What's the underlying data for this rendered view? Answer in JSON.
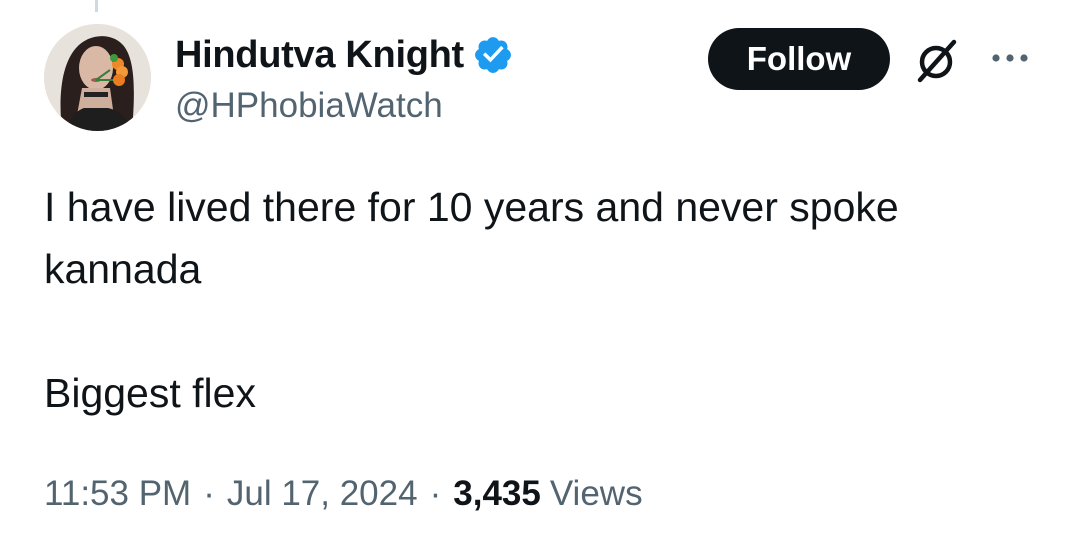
{
  "tweet": {
    "author": {
      "display_name": "Hindutva Knight",
      "handle": "@HPhobiaWatch",
      "verified": true,
      "verified_color": "#1d9bf0",
      "avatar_icon": "avatar-photo"
    },
    "actions": {
      "follow_label": "Follow",
      "grok_icon": "grok-icon",
      "more_icon": "more-options-icon"
    },
    "text": "I have lived there for 10 years and never spoke kannada\n\nBiggest flex",
    "meta": {
      "time": "11:53 PM",
      "separator": "·",
      "date": "Jul 17, 2024",
      "views_count": "3,435",
      "views_label": "Views"
    }
  },
  "colors": {
    "text_primary": "#0f1419",
    "text_secondary": "#536471",
    "follow_bg": "#0f1419",
    "follow_text": "#ffffff"
  }
}
